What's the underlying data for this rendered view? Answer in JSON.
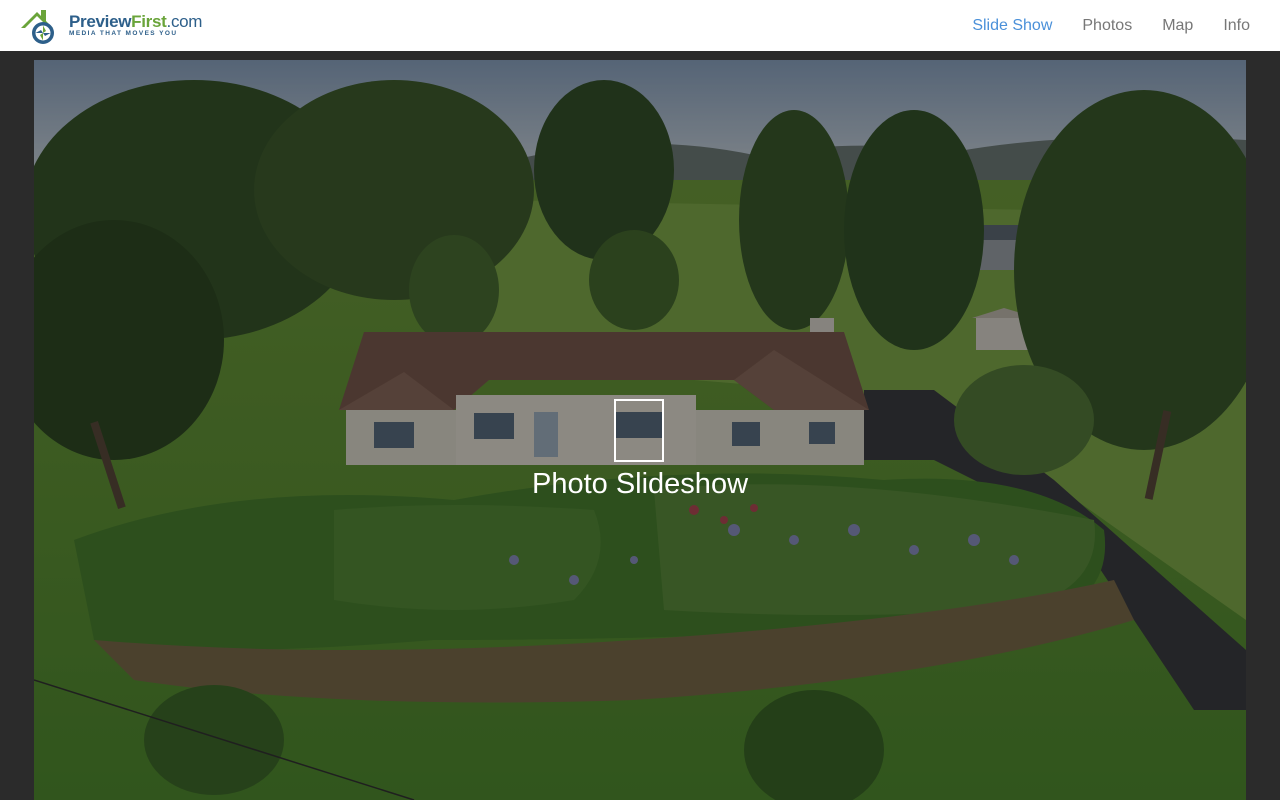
{
  "brand": {
    "name_part1": "Preview",
    "name_part2": "First",
    "name_part3": ".com",
    "tagline": "MEDIA THAT MOVES YOU",
    "colors": {
      "blue": "#2d5f8a",
      "green": "#6aa43a"
    }
  },
  "nav": {
    "items": [
      {
        "label": "Slide Show",
        "active": true
      },
      {
        "label": "Photos",
        "active": false
      },
      {
        "label": "Map",
        "active": false
      },
      {
        "label": "Info",
        "active": false
      }
    ],
    "active_color": "#4a90d9",
    "inactive_color": "#777777"
  },
  "hero": {
    "label": "Photo Slideshow",
    "icon": "slideshow-frame-icon",
    "image": "aerial-house-photo"
  }
}
